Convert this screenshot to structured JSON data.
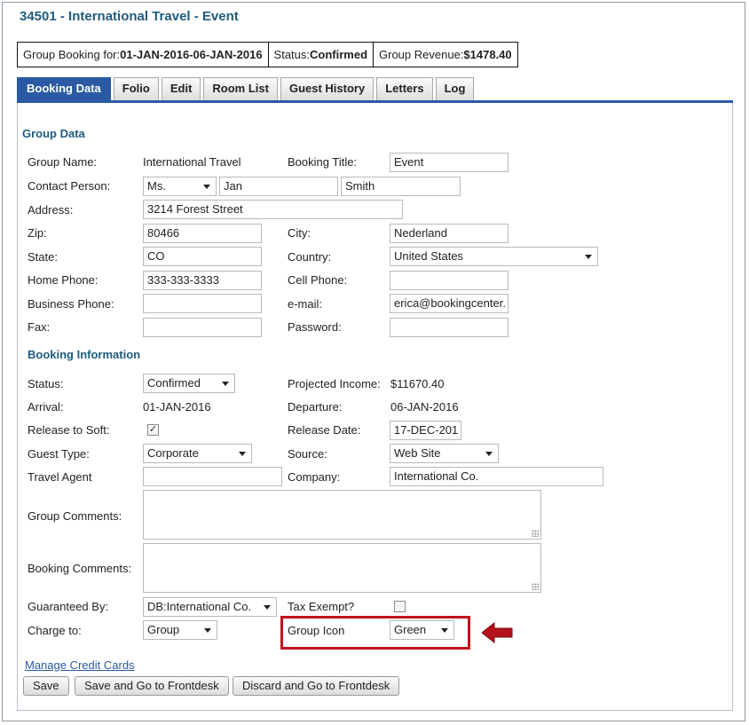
{
  "page": {
    "title": "34501 - International Travel - Event"
  },
  "summary": {
    "group_booking_label": "Group Booking for:",
    "group_booking_value": "01-JAN-2016-06-JAN-2016",
    "status_label": "Status:",
    "status_value": "Confirmed",
    "revenue_label": "Group Revenue:",
    "revenue_value": "$1478.40"
  },
  "tabs": [
    {
      "label": "Booking Data",
      "active": true
    },
    {
      "label": "Folio"
    },
    {
      "label": "Edit"
    },
    {
      "label": "Room List"
    },
    {
      "label": "Guest History"
    },
    {
      "label": "Letters"
    },
    {
      "label": "Log"
    }
  ],
  "group_data": {
    "heading": "Group Data",
    "group_name_label": "Group Name:",
    "group_name_value": "International Travel",
    "booking_title_label": "Booking Title:",
    "booking_title_value": "Event",
    "contact_person_label": "Contact Person:",
    "salutation_value": "Ms.",
    "first_name_value": "Jan",
    "last_name_value": "Smith",
    "address_label": "Address:",
    "address_value": "3214 Forest Street",
    "zip_label": "Zip:",
    "zip_value": "80466",
    "city_label": "City:",
    "city_value": "Nederland",
    "state_label": "State:",
    "state_value": "CO",
    "country_label": "Country:",
    "country_value": "United States",
    "home_phone_label": "Home Phone:",
    "home_phone_value": "333-333-3333",
    "cell_phone_label": "Cell Phone:",
    "cell_phone_value": "",
    "business_phone_label": "Business Phone:",
    "business_phone_value": "",
    "email_label": "e-mail:",
    "email_value": "erica@bookingcenter.",
    "fax_label": "Fax:",
    "fax_value": "",
    "password_label": "Password:",
    "password_value": ""
  },
  "booking_info": {
    "heading": "Booking Information",
    "status_label": "Status:",
    "status_value": "Confirmed",
    "projected_income_label": "Projected Income:",
    "projected_income_value": "$11670.40",
    "arrival_label": "Arrival:",
    "arrival_value": "01-JAN-2016",
    "departure_label": "Departure:",
    "departure_value": "06-JAN-2016",
    "release_to_soft_label": "Release to Soft:",
    "release_to_soft_checked": true,
    "release_date_label": "Release Date:",
    "release_date_value": "17-DEC-201",
    "guest_type_label": "Guest Type:",
    "guest_type_value": "Corporate",
    "source_label": "Source:",
    "source_value": "Web Site",
    "travel_agent_label": "Travel Agent",
    "travel_agent_value": "",
    "company_label": "Company:",
    "company_value": "International Co.",
    "group_comments_label": "Group Comments:",
    "booking_comments_label": "Booking Comments:",
    "guaranteed_by_label": "Guaranteed By:",
    "guaranteed_by_value": "DB:International Co.",
    "tax_exempt_label": "Tax Exempt?",
    "tax_exempt_checked": false,
    "charge_to_label": "Charge to:",
    "charge_to_value": "Group",
    "group_icon_label": "Group Icon",
    "group_icon_value": "Green"
  },
  "actions": {
    "manage_credit_cards": "Manage Credit Cards",
    "save": "Save",
    "save_frontdesk": "Save and Go to Frontdesk",
    "discard_frontdesk": "Discard and Go to Frontdesk"
  },
  "colors": {
    "accent": "#2a5aa4",
    "heading": "#1f5a7e",
    "highlight": "#c0141e"
  },
  "icons": {
    "dropdown": "chevron-down-icon",
    "pointer": "arrow-left-icon",
    "check": "checkmark-icon"
  }
}
